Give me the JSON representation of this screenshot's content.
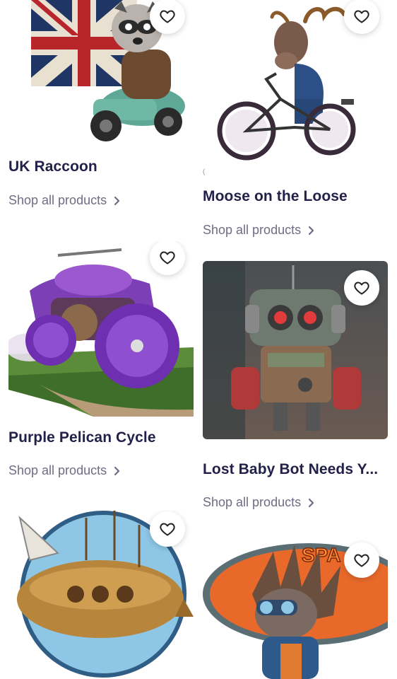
{
  "products": [
    {
      "title": "UK Raccoon",
      "link": "Shop all products",
      "icon": "heart-outline-icon"
    },
    {
      "title": "Moose on the Loose",
      "link": "Shop all products",
      "icon": "heart-outline-icon"
    },
    {
      "title": "Purple Pelican Cycle",
      "link": "Shop all products",
      "icon": "heart-outline-icon"
    },
    {
      "title": "Lost Baby Bot Needs Y...",
      "link": "Shop all products",
      "icon": "heart-outline-icon"
    },
    {
      "title": "",
      "link": "",
      "icon": "heart-outline-icon"
    },
    {
      "title": "",
      "link": "",
      "icon": "heart-outline-icon"
    }
  ],
  "colors": {
    "title": "#23214a",
    "link": "#6e6d85",
    "fav_bg": "#ffffff"
  }
}
